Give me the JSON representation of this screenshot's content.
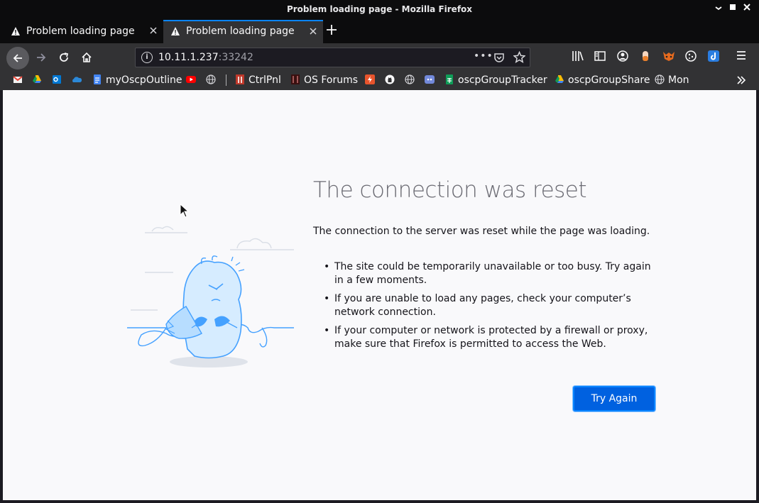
{
  "window": {
    "title": "Problem loading page - Mozilla Firefox"
  },
  "tabs": [
    {
      "label": "Problem loading page",
      "active": false
    },
    {
      "label": "Problem loading page",
      "active": true
    }
  ],
  "navbar": {
    "url_host": "10.11.1.237",
    "url_port": ":33242"
  },
  "bookmarks": [
    {
      "label": "",
      "icon": "gmail-icon",
      "color": "#ea4335"
    },
    {
      "label": "",
      "icon": "google-drive-icon",
      "color": "#fbbc04"
    },
    {
      "label": "",
      "icon": "outlook-icon",
      "color": "#0078d4"
    },
    {
      "label": "",
      "icon": "onedrive-icon",
      "color": "#2b88d8"
    },
    {
      "label": "myOscpOutline",
      "icon": "google-docs-icon",
      "color": "#4285f4"
    },
    {
      "label": "",
      "icon": "youtube-icon",
      "color": "#ff0000"
    },
    {
      "label": "",
      "icon": "globe-icon",
      "color": "#d7d7db"
    },
    {
      "label": "CtrlPnl",
      "icon": "ctrlpnl-icon",
      "color": "#c0392b"
    },
    {
      "label": "OS Forums",
      "icon": "forums-icon",
      "color": "#7a1f1f"
    },
    {
      "label": "",
      "icon": "bolt-icon",
      "color": "#e8542c"
    },
    {
      "label": "",
      "icon": "github-icon",
      "color": "#f9f9fa"
    },
    {
      "label": "",
      "icon": "globe-icon",
      "color": "#d7d7db"
    },
    {
      "label": "",
      "icon": "discord-icon",
      "color": "#7289da"
    },
    {
      "label": "oscpGroupTracker",
      "icon": "google-sheets-icon",
      "color": "#0f9d58"
    },
    {
      "label": "oscpGroupShare",
      "icon": "google-drive-icon",
      "color": "#fbbc04"
    },
    {
      "label": "Mon",
      "icon": "globe-icon",
      "color": "#d7d7db"
    }
  ],
  "page": {
    "title": "The connection was reset",
    "description": "The connection to the server was reset while the page was loading.",
    "bullets": [
      "The site could be temporarily unavailable or too busy. Try again in a few moments.",
      "If you are unable to load any pages, check your computer’s network connection.",
      "If your computer or network is protected by a firewall or proxy, make sure that Firefox is permitted to access the Web."
    ],
    "try_again_label": "Try Again"
  },
  "colors": {
    "accent": "#0a84ff",
    "button": "#0061e0",
    "toolbar": "#323234",
    "titlebar": "#0c0c0d",
    "content_bg": "#f9f9fb"
  }
}
